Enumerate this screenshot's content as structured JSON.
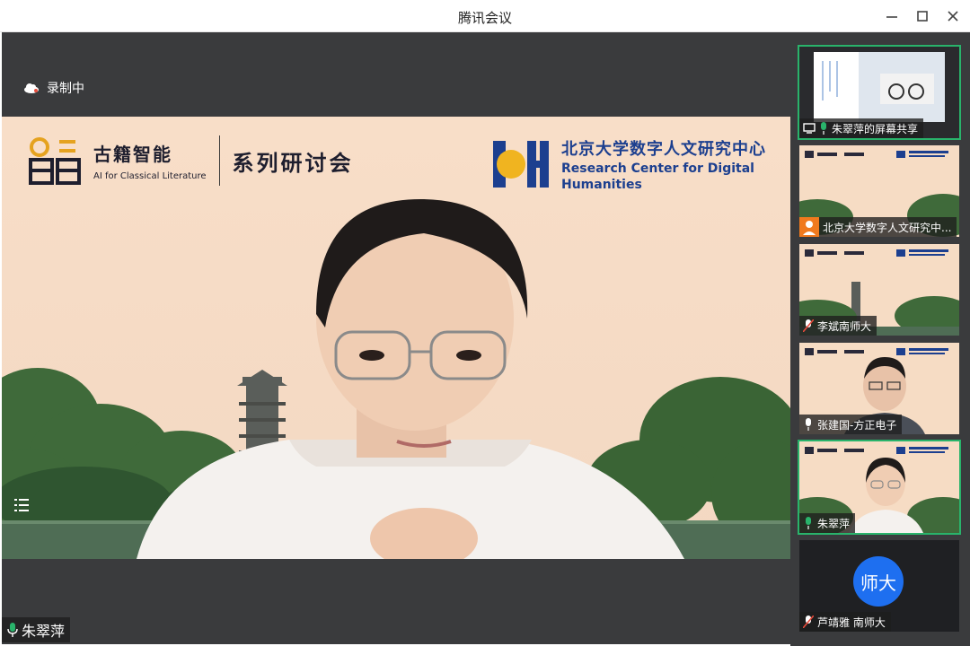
{
  "window": {
    "title": "腾讯会议",
    "minimize_icon": "minimize-icon",
    "maximize_icon": "maximize-icon",
    "close_icon": "close-icon"
  },
  "recording": {
    "label": "录制中",
    "icon": "cloud-icon"
  },
  "banner": {
    "left_cn": "古籍智能",
    "left_en": "AI for Classical Literature",
    "series": "系列研讨会",
    "right_cn": "北京大学数字人文研究中心",
    "right_en_line1": "Research Center for Digital",
    "right_en_line2": "Humanities"
  },
  "speaker": {
    "name": "朱翠萍",
    "mic": "mic-on"
  },
  "participants": [
    {
      "name": "朱翠萍的屏幕共享",
      "type": "screen-share",
      "active": true
    },
    {
      "name": "北京大学数字人文研究中...",
      "type": "avatar-person"
    },
    {
      "name": "李斌南师大",
      "type": "banner",
      "mic": "muted"
    },
    {
      "name": "张建国-方正电子",
      "type": "person",
      "mic": "on"
    },
    {
      "name": "朱翠萍",
      "type": "person",
      "mic": "on",
      "active": true
    },
    {
      "name": "芦靖雅 南师大",
      "type": "avatar",
      "mic": "muted",
      "avatar_text": "师大"
    }
  ],
  "colors": {
    "accent_green": "#29b36b",
    "avatar_blue": "#1e6ff0",
    "banner_bg": "#f6dcc4",
    "dh_blue": "#1c3f8f"
  }
}
